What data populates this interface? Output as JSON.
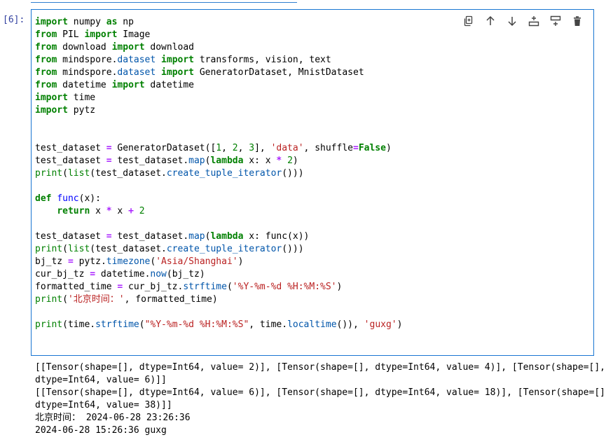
{
  "cell": {
    "prompt": "[6]:"
  },
  "toolbar": {
    "buttons": [
      "duplicate-icon",
      "move-up-icon",
      "move-down-icon",
      "insert-below-icon",
      "insert-above-icon",
      "delete-icon"
    ]
  },
  "code_lines": [
    "import numpy as np",
    "from PIL import Image",
    "from download import download",
    "from mindspore.dataset import transforms, vision, text",
    "from mindspore.dataset import GeneratorDataset, MnistDataset",
    "from datetime import datetime",
    "import time",
    "import pytz",
    "",
    "",
    "test_dataset = GeneratorDataset([1, 2, 3], 'data', shuffle=False)",
    "test_dataset = test_dataset.map(lambda x: x * 2)",
    "print(list(test_dataset.create_tuple_iterator()))",
    "",
    "def func(x):",
    "    return x * x + 2",
    "",
    "test_dataset = test_dataset.map(lambda x: func(x))",
    "print(list(test_dataset.create_tuple_iterator()))",
    "bj_tz = pytz.timezone('Asia/Shanghai')",
    "cur_bj_tz = datetime.now(bj_tz)",
    "formatted_time = cur_bj_tz.strftime('%Y-%m-%d %H:%M:%S')",
    "print('北京时间：', formatted_time)",
    "",
    "print(time.strftime(\"%Y-%m-%d %H:%M:%S\", time.localtime()), 'guxg')"
  ],
  "output_lines": [
    "[[Tensor(shape=[], dtype=Int64, value= 2)], [Tensor(shape=[], dtype=Int64, value= 4)], [Tensor(shape=[],",
    "dtype=Int64, value= 6)]]",
    "[[Tensor(shape=[], dtype=Int64, value= 6)], [Tensor(shape=[], dtype=Int64, value= 18)], [Tensor(shape=[],",
    "dtype=Int64, value= 38)]]",
    "北京时间： 2024-06-28 23:26:36",
    "2024-06-28 15:26:36 guxg"
  ]
}
